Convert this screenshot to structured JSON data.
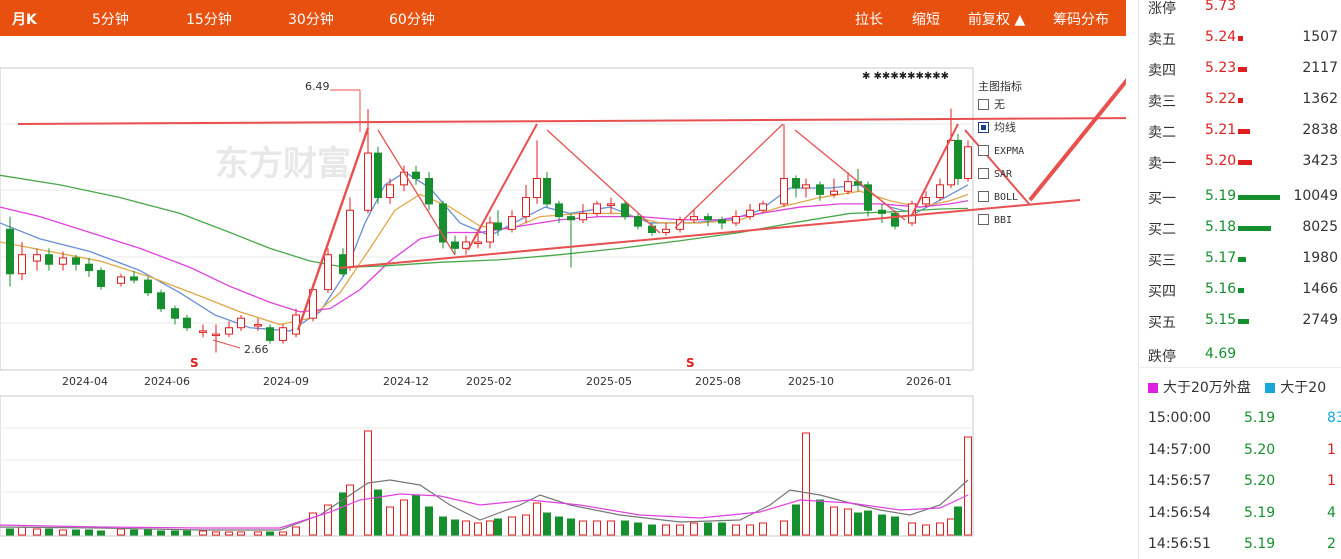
{
  "toolbar": {
    "tabs": [
      "月K",
      "5分钟",
      "15分钟",
      "30分钟",
      "60分钟"
    ],
    "actions": [
      "拉长",
      "缩短",
      "前复权 ▲",
      "筹码分布"
    ]
  },
  "chart": {
    "watermark": "东方财富",
    "high_label": "6.49",
    "low_label": "2.66",
    "top_markers": "✱ ✱✱✱✱✱✱✱✱✱",
    "signal_marker": "S",
    "x_ticks": [
      "2024-04",
      "2024-06",
      "2024-09",
      "2024-12",
      "2025-02",
      "2025-05",
      "2025-08",
      "2025-10",
      "2026-01"
    ],
    "colors": {
      "up": "#e02020",
      "down": "#16902f",
      "ma5": "#6a8fd6",
      "ma10": "#e0a848",
      "ma20": "#e040e0",
      "ma60": "#4aa84a",
      "annot": "#e85050"
    }
  },
  "chart_data": {
    "type": "candlestick",
    "x_range": [
      "2024-02",
      "2026-01"
    ],
    "ylim": [
      2.4,
      6.9
    ],
    "price_lines": {
      "resistance": 6.1,
      "high": 6.49,
      "low": 2.66
    },
    "notes": "Monthly K-line with volume subchart; resistance line near 6.1 and rising support line from ~4.2 to ~5.2"
  },
  "legend": {
    "title": "主图指标",
    "items": [
      {
        "name": "无",
        "checked": false
      },
      {
        "name": "均线",
        "checked": true
      },
      {
        "name": "EXPMA",
        "checked": false
      },
      {
        "name": "SAR",
        "checked": false
      },
      {
        "name": "BOLL",
        "checked": false
      },
      {
        "name": "BBI",
        "checked": false
      }
    ]
  },
  "order_book": {
    "top_label": "涨停",
    "top_price": "5.73",
    "sells": [
      {
        "label": "卖五",
        "price": "5.24",
        "vol": "1507",
        "bar": 5
      },
      {
        "label": "卖四",
        "price": "5.23",
        "vol": "2117",
        "bar": 9
      },
      {
        "label": "卖三",
        "price": "5.22",
        "vol": "1362",
        "bar": 5
      },
      {
        "label": "卖二",
        "price": "5.21",
        "vol": "2838",
        "bar": 12
      },
      {
        "label": "卖一",
        "price": "5.20",
        "vol": "3423",
        "bar": 14
      }
    ],
    "buys": [
      {
        "label": "买一",
        "price": "5.19",
        "vol": "10049",
        "bar": 42
      },
      {
        "label": "买二",
        "price": "5.18",
        "vol": "8025",
        "bar": 33
      },
      {
        "label": "买三",
        "price": "5.17",
        "vol": "1980",
        "bar": 8
      },
      {
        "label": "买四",
        "price": "5.16",
        "vol": "1466",
        "bar": 6
      },
      {
        "label": "买五",
        "price": "5.15",
        "vol": "2749",
        "bar": 11
      }
    ],
    "bottom_label": "跌停",
    "bottom_price": "4.69"
  },
  "trade_legend": {
    "a": "大于20万外盘",
    "b": "大于20"
  },
  "ticks": [
    {
      "time": "15:00:00",
      "price": "5.19",
      "vol": "83",
      "pc": "green",
      "vc": "cyan"
    },
    {
      "time": "14:57:00",
      "price": "5.20",
      "vol": "1",
      "pc": "green",
      "vc": "red"
    },
    {
      "time": "14:56:57",
      "price": "5.20",
      "vol": "1",
      "pc": "green",
      "vc": "red"
    },
    {
      "time": "14:56:54",
      "price": "5.19",
      "vol": "4",
      "pc": "green",
      "vc": "green"
    },
    {
      "time": "14:56:51",
      "price": "5.19",
      "vol": "2",
      "pc": "green",
      "vc": "green"
    }
  ]
}
